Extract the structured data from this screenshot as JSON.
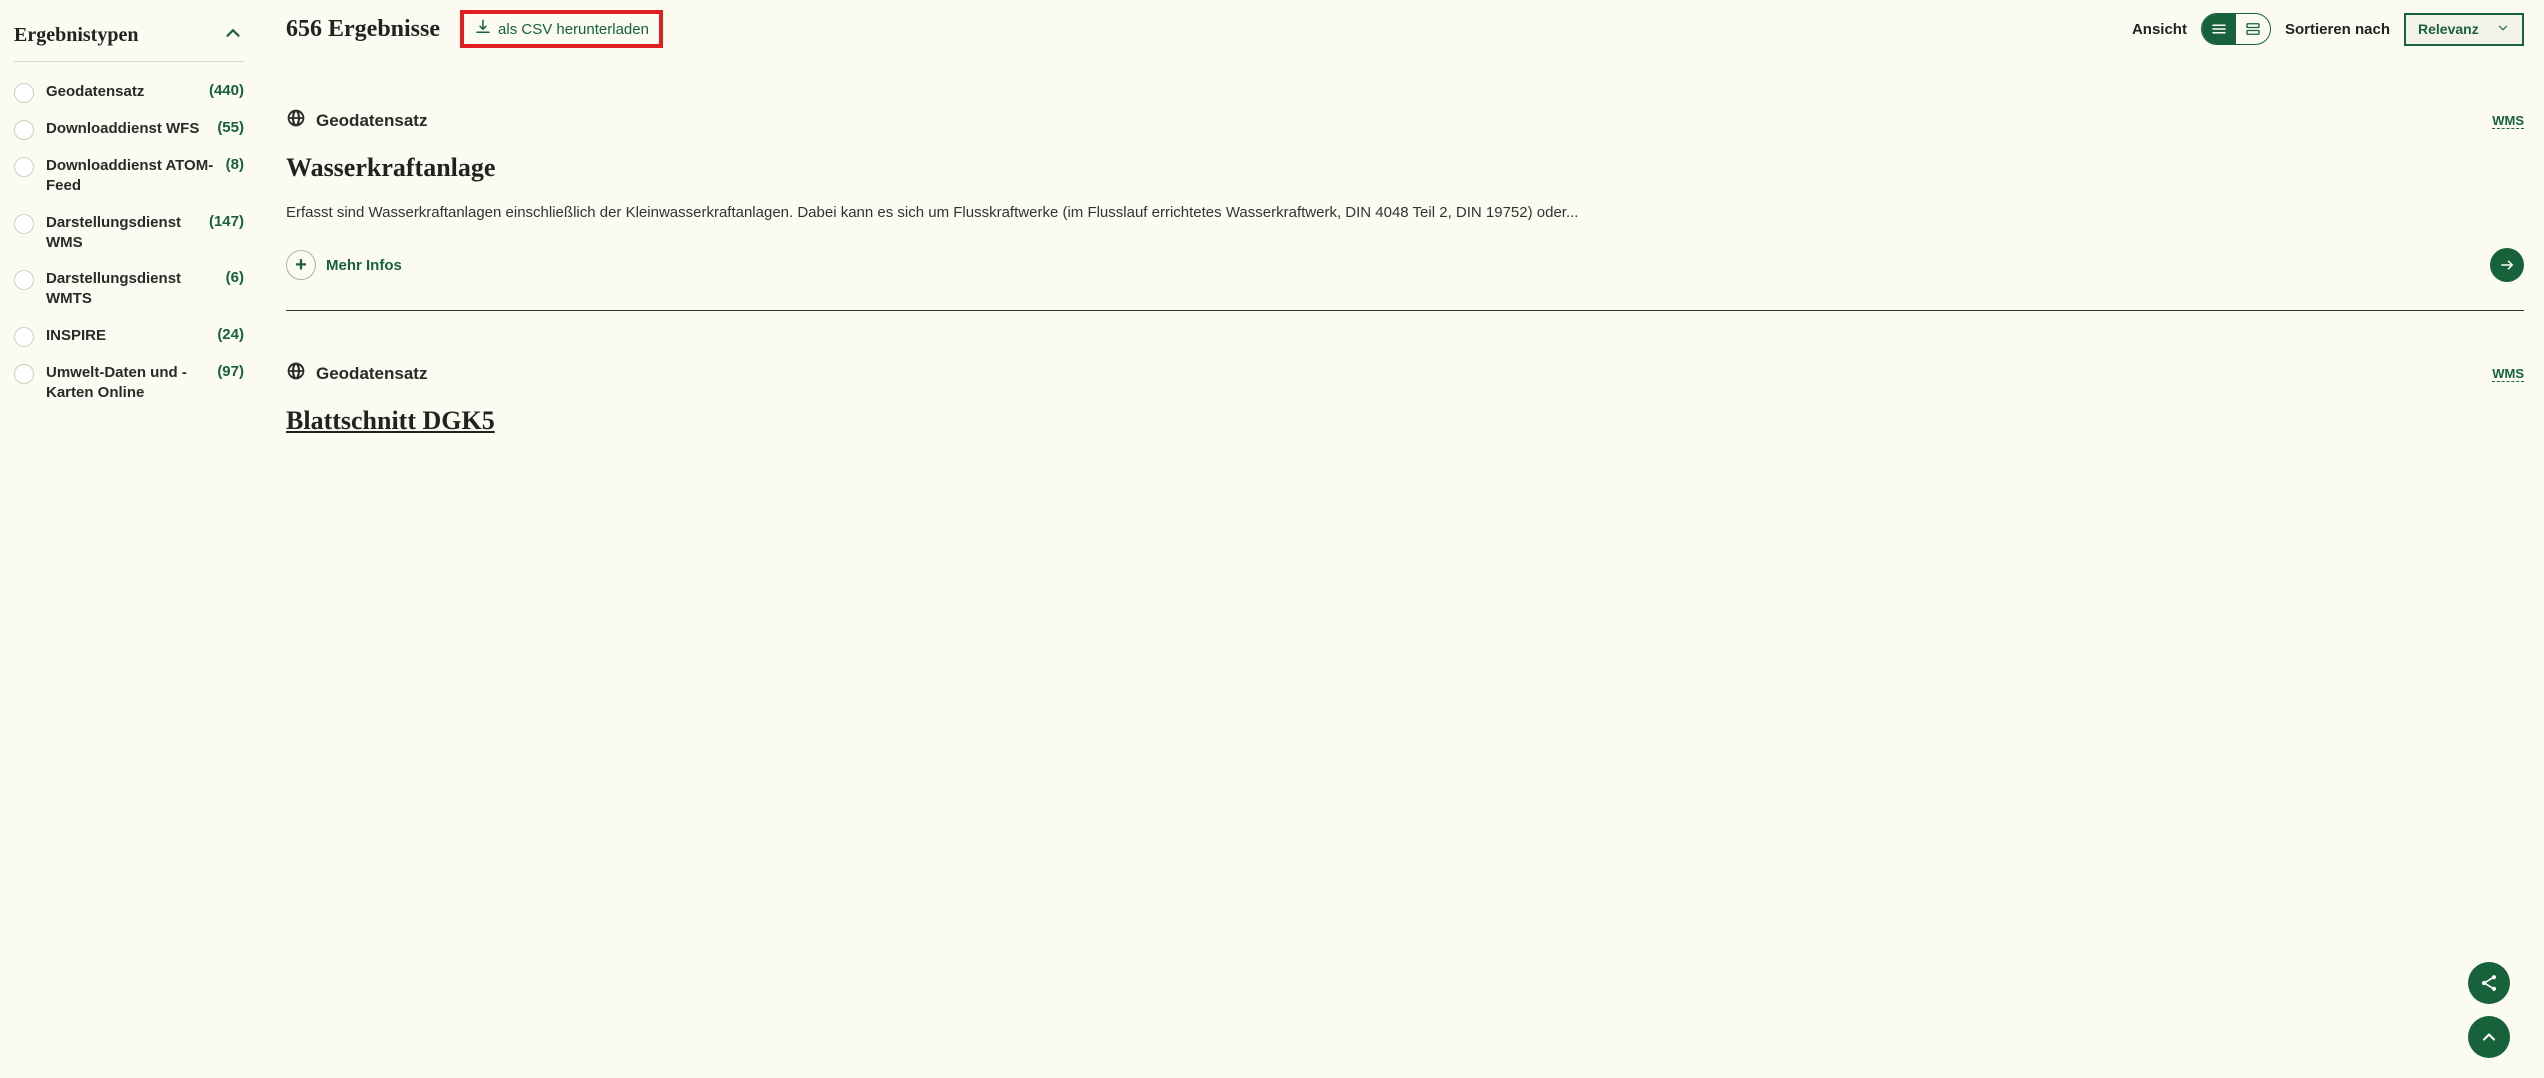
{
  "sidebar": {
    "title": "Ergebnistypen",
    "filters": [
      {
        "label": "Geodatensatz",
        "count": "(440)"
      },
      {
        "label": "Downloaddienst WFS",
        "count": "(55)"
      },
      {
        "label": "Downloaddienst ATOM-Feed",
        "count": "(8)"
      },
      {
        "label": "Darstellungsdienst WMS",
        "count": "(147)"
      },
      {
        "label": "Darstellungsdienst WMTS",
        "count": "(6)"
      },
      {
        "label": "INSPIRE",
        "count": "(24)"
      },
      {
        "label": "Umwelt-Daten und -Karten Online",
        "count": "(97)"
      }
    ]
  },
  "header": {
    "count_text": "656 Ergebnisse",
    "csv_text": "als CSV herunterladen",
    "view_label": "Ansicht",
    "sort_label": "Sortieren nach",
    "sort_value": "Relevanz"
  },
  "results": [
    {
      "type": "Geodatensatz",
      "badge": "WMS",
      "title": "Wasserkraftanlage",
      "desc": "Erfasst sind Wasserkraftanlagen einschließlich der Kleinwasserkraftanlagen. Dabei kann es sich um Flusskraftwerke (im Flusslauf errichtetes Wasserkraftwerk, DIN 4048 Teil 2, DIN 19752) oder...",
      "more": "Mehr Infos"
    },
    {
      "type": "Geodatensatz",
      "badge": "WMS",
      "title": "Blattschnitt DGK5"
    }
  ]
}
